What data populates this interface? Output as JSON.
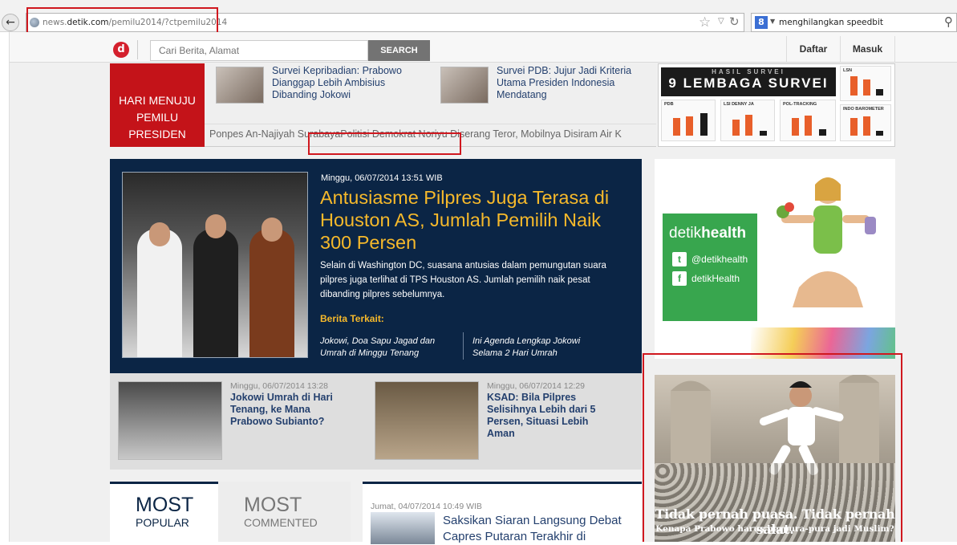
{
  "browser": {
    "url_prefix": "news.",
    "url_domain": "detik.com",
    "url_path": "/pemilu2014/?ctpemilu2014",
    "search_engine_letter": "8",
    "search_query": "menghilangkan speedbit"
  },
  "site": {
    "logo_letter": "d",
    "search_placeholder": "Cari Berita, Alamat",
    "search_button": "SEARCH",
    "register_link": "Daftar",
    "login_link": "Masuk"
  },
  "election": {
    "countdown_label": "HARI MENUJU PEMILU PRESIDEN",
    "strip_stories": [
      {
        "title": "Survei Kepribadian: Prabowo Dianggap Lebih Ambisius Dibanding Jokowi"
      },
      {
        "title": "Survei PDB: Jujur Jadi Kriteria Utama Presiden Indonesia Mendatang"
      }
    ],
    "ticker": "Ponpes An-Najiyah SurabayaPolitisi Demokrat Noriyu Diserang Teror, Mobilnya Disiram Air K",
    "survey_ad": {
      "kicker": "HASIL SURVEI",
      "headline": "9 LEMBAGA SURVEI",
      "charts": [
        "PDB",
        "LSI DENNY JA",
        "POL-TRACKING",
        "LSN",
        "INDO BAROMETER"
      ]
    }
  },
  "feature": {
    "date": "Minggu, 06/07/2014 13:51 WIB",
    "title": "Antusiasme Pilpres Juga Terasa di Houston AS, Jumlah Pemilih Naik 300 Persen",
    "summary": "Selain di Washington DC, suasana antusias dalam pemungutan suara pilpres juga terlihat di TPS Houston AS. Jumlah pemilih naik pesat dibanding pilpres sebelumnya.",
    "related_label": "Berita Terkait:",
    "related": [
      {
        "title": "Jokowi, Doa Sapu Jagad dan Umrah di Minggu Tenang"
      },
      {
        "title": "Ini Agenda Lengkap Jokowi Selama 2 Hari Umrah"
      }
    ]
  },
  "secondary": [
    {
      "date": "Minggu, 06/07/2014 13:28",
      "title": "Jokowi Umrah di Hari Tenang, ke Mana Prabowo Subianto?"
    },
    {
      "date": "Minggu, 06/07/2014 12:29",
      "title": "KSAD: Bila Pilpres Selisihnya Lebih dari 5 Persen, Situasi Lebih Aman"
    }
  ],
  "most_tabs": {
    "popular_big": "MOST",
    "popular_small": "POPULAR",
    "commented_big": "MOST",
    "commented_small": "COMMENTED"
  },
  "video": {
    "date": "Jumat, 04/07/2014 10:49 WIB",
    "title": "Saksikan Siaran Langsung Debat Capres Putaran Terakhir di"
  },
  "health_ad": {
    "brand_light": "detik",
    "brand_bold": "health",
    "twitter": "@detikhealth",
    "facebook": "detikHealth"
  },
  "mosque_ad": {
    "headline": "Tidak pernah puasa. Tidak pernah salat.",
    "subline": "Kenapa Prabowo harus berpura-pura jadi Muslim?"
  },
  "colors": {
    "accent_red": "#c41319",
    "navy": "#0b2545",
    "gold": "#f6b92b",
    "link_blue": "#24406e",
    "health_green": "#38a64e",
    "highlight_red": "#d0181f"
  }
}
